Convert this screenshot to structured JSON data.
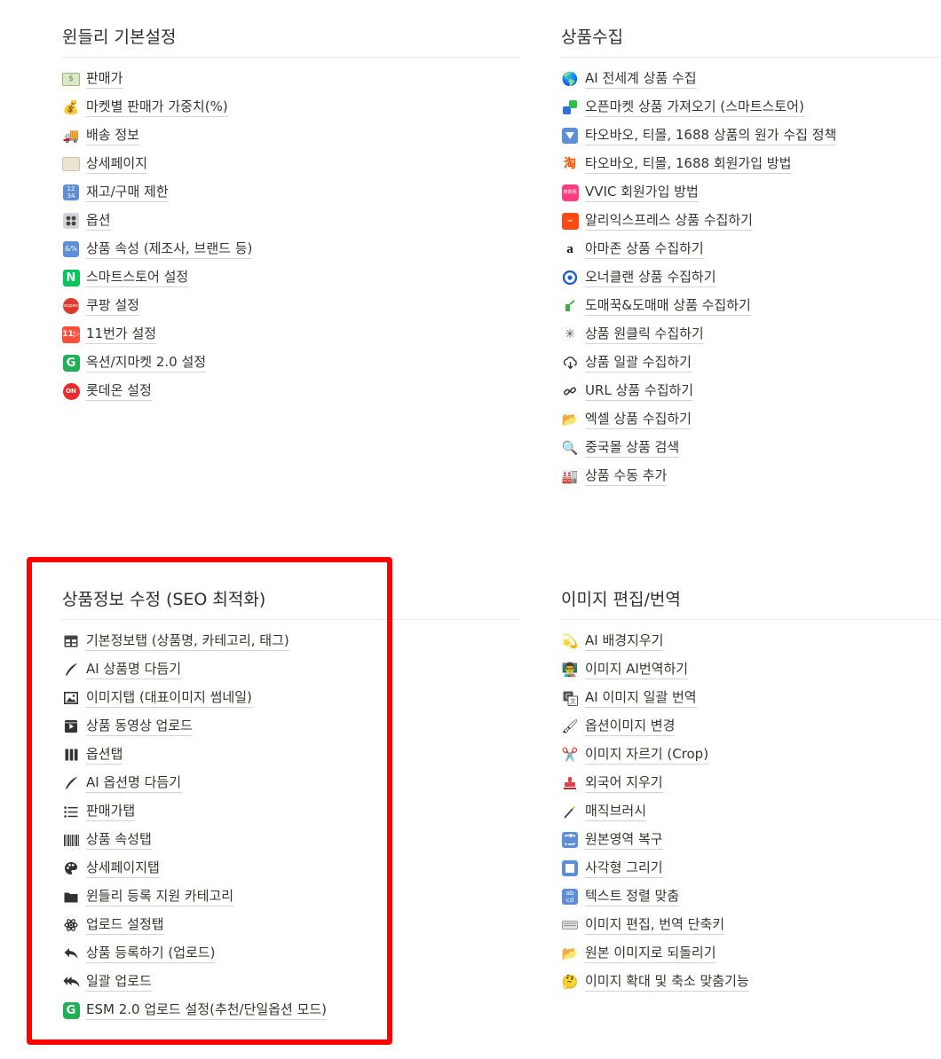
{
  "highlight_color": "#ff0000",
  "sections": {
    "basic": {
      "title": "윈들리 기본설정",
      "items": [
        {
          "label": "판매가",
          "icon": "money-bill-icon"
        },
        {
          "label": "마켓별 판매가 가중치(%)",
          "icon": "money-bag-icon"
        },
        {
          "label": "배송 정보",
          "icon": "delivery-truck-icon"
        },
        {
          "label": "상세페이지",
          "icon": "scroll-icon"
        },
        {
          "label": "재고/구매 제한",
          "icon": "numbers-icon"
        },
        {
          "label": "옵션",
          "icon": "control-knobs-icon"
        },
        {
          "label": "상품 속성 (제조사, 브랜드 등)",
          "icon": "symbols-icon"
        },
        {
          "label": "스마트스토어 설정",
          "icon": "naver-logo-icon"
        },
        {
          "label": "쿠팡 설정",
          "icon": "coupang-logo-icon"
        },
        {
          "label": "11번가 설정",
          "icon": "11st-logo-icon"
        },
        {
          "label": "옥션/지마켓 2.0 설정",
          "icon": "gmarket-logo-icon"
        },
        {
          "label": "롯데온 설정",
          "icon": "lotteon-logo-icon"
        }
      ]
    },
    "collect": {
      "title": "상품수집",
      "items": [
        {
          "label": "AI 전세계 상품 수집",
          "icon": "globe-icon"
        },
        {
          "label": "오픈마켓 상품 가져오기 (스마트스토어)",
          "icon": "openmarket-icon"
        },
        {
          "label": "타오바오, 티몰, 1688 상품의 원가 수집 정책",
          "icon": "down-triangle-icon"
        },
        {
          "label": "타오바오, 티몰, 1688 회원가입 방법",
          "icon": "taobao-logo-icon"
        },
        {
          "label": "VVIC 회원가입 방법",
          "icon": "vvic-logo-icon"
        },
        {
          "label": "알리익스프레스 상품 수집하기",
          "icon": "aliexpress-logo-icon"
        },
        {
          "label": "아마존 상품 수집하기",
          "icon": "amazon-logo-icon"
        },
        {
          "label": "오너클랜 상품 수집하기",
          "icon": "ownerclan-logo-icon"
        },
        {
          "label": "도매꾹&도매매 상품 수집하기",
          "icon": "domeggook-logo-icon"
        },
        {
          "label": "상품 원클릭 수집하기",
          "icon": "sparkle-click-icon"
        },
        {
          "label": "상품 일괄 수집하기",
          "icon": "cloud-download-icon"
        },
        {
          "label": "URL 상품 수집하기",
          "icon": "link-icon"
        },
        {
          "label": "엑셀 상품 수집하기",
          "icon": "folder-open-icon"
        },
        {
          "label": "중국몰 상품 검색",
          "icon": "magnifier-icon"
        },
        {
          "label": "상품 수동 추가",
          "icon": "factory-icon"
        }
      ]
    },
    "seo": {
      "title": "상품정보 수정 (SEO 최적화)",
      "items": [
        {
          "label": "기본정보탭 (상품명, 카테고리, 태그)",
          "icon": "table-icon"
        },
        {
          "label": "AI 상품명 다듬기",
          "icon": "feather-pen-icon"
        },
        {
          "label": "이미지탭 (대표이미지 썸네일)",
          "icon": "image-icon"
        },
        {
          "label": "상품 동영상 업로드",
          "icon": "video-icon"
        },
        {
          "label": "옵션탭",
          "icon": "columns-icon"
        },
        {
          "label": "AI 옵션명 다듬기",
          "icon": "feather-pen-icon"
        },
        {
          "label": "판매가탭",
          "icon": "list-icon"
        },
        {
          "label": "상품 속성탭",
          "icon": "barcode-icon"
        },
        {
          "label": "상세페이지탭",
          "icon": "palette-icon"
        },
        {
          "label": "윈들리 등록 지원 카테고리",
          "icon": "folder-icon"
        },
        {
          "label": "업로드 설정탭",
          "icon": "atom-icon"
        },
        {
          "label": "상품 등록하기 (업로드)",
          "icon": "reply-icon"
        },
        {
          "label": "일괄 업로드",
          "icon": "reply-all-icon"
        },
        {
          "label": "ESM 2.0 업로드 설정(추천/단일옵션 모드)",
          "icon": "gmarket-logo-icon"
        }
      ]
    },
    "image": {
      "title": "이미지 편집/번역",
      "items": [
        {
          "label": "AI 배경지우기",
          "icon": "dizzy-icon"
        },
        {
          "label": "이미지 AI번역하기",
          "icon": "teacher-icon"
        },
        {
          "label": "AI 이미지 일괄 번역",
          "icon": "translate-icon"
        },
        {
          "label": "옵션이미지 변경",
          "icon": "paintbrush-icon"
        },
        {
          "label": "이미지 자르기 (Crop)",
          "icon": "scissors-icon"
        },
        {
          "label": "외국어 지우기",
          "icon": "stamp-icon"
        },
        {
          "label": "매직브러시",
          "icon": "magic-wand-icon"
        },
        {
          "label": "원본영역 복구",
          "icon": "repeat-icon"
        },
        {
          "label": "사각형 그리기",
          "icon": "square-icon"
        },
        {
          "label": "텍스트 정렬 맞춤",
          "icon": "abcd-icon"
        },
        {
          "label": "이미지 편집, 번역 단축키",
          "icon": "keyboard-icon"
        },
        {
          "label": "원본 이미지로 되돌리기",
          "icon": "folder-open-icon"
        },
        {
          "label": "이미지 확대 및 축소 맞춤기능",
          "icon": "thinking-face-icon"
        }
      ]
    }
  }
}
